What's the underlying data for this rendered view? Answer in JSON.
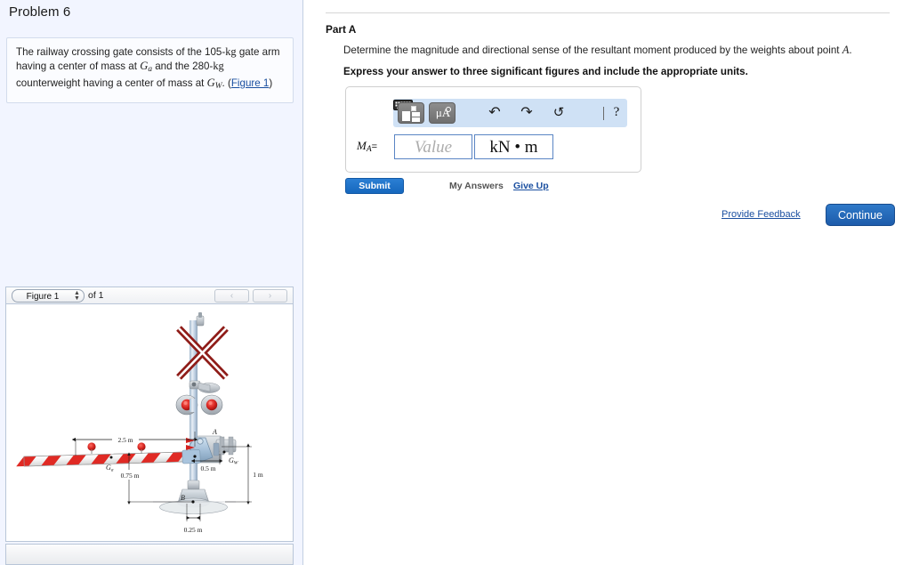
{
  "problem": {
    "title": "Problem 6",
    "statement_parts": {
      "p1": "The railway crossing gate consists of the 105-",
      "kg1": "kg",
      "p2": " gate arm having a center of mass at ",
      "ga": "G",
      "ga_sub": "a",
      "p3": " and the 280-",
      "kg2": "kg",
      "p4": " counterweight having a center of mass at ",
      "gw": "G",
      "gw_sub": "W",
      "p5": ". (",
      "figure_link": "Figure 1",
      "p6": ")"
    }
  },
  "figure_panel": {
    "selected_figure": "Figure 1",
    "of_label": "of 1",
    "prev_label": "‹",
    "next_label": "›"
  },
  "part": {
    "title": "Part A",
    "question_pre": "Determine the magnitude and directional sense of the resultant moment produced by the weights about point ",
    "question_point": "A",
    "question_post": ".",
    "instruction": "Express your answer to three significant figures and include the appropriate units."
  },
  "answer": {
    "variable": "M",
    "variable_sub": "A",
    "equals": "=",
    "value_placeholder": "Value",
    "unit_value": "kN • m",
    "toolbar": {
      "template_label": "template-icon",
      "units_label": "μA",
      "undo": "↶",
      "redo": "↷",
      "reset": "↺",
      "keyboard": "keyboard-icon",
      "help": "?"
    }
  },
  "actions": {
    "submit": "Submit",
    "my_answers": "My Answers",
    "give_up": "Give Up",
    "provide_feedback": "Provide Feedback",
    "continue": "Continue"
  },
  "diagram": {
    "labels": {
      "dim_arm": "2.5 m",
      "dim_arm_drop": "0.75 m",
      "dim_cw": "0.5 m",
      "dim_height": "1 m",
      "dim_base": "0.25 m",
      "point_a": "A",
      "point_b": "B",
      "cg_arm": "G",
      "cg_arm_sub": "a",
      "cg_weight": "G",
      "cg_weight_sub": "W"
    },
    "colors": {
      "stripe_red": "#e02a24",
      "stripe_white": "#ffffff",
      "steel_blue": "#a9c4dd",
      "gray_metal": "#b9bec4",
      "sign_dark_red": "#8f1c18",
      "lamp_red": "#d4211d"
    }
  },
  "theme": {
    "panel_bg": "#f2f5ff",
    "link_color": "#1a4fa0",
    "accent_blue": "#1667bd",
    "toolbar_bg": "#cfe1f5",
    "input_border": "#5a85c4"
  }
}
